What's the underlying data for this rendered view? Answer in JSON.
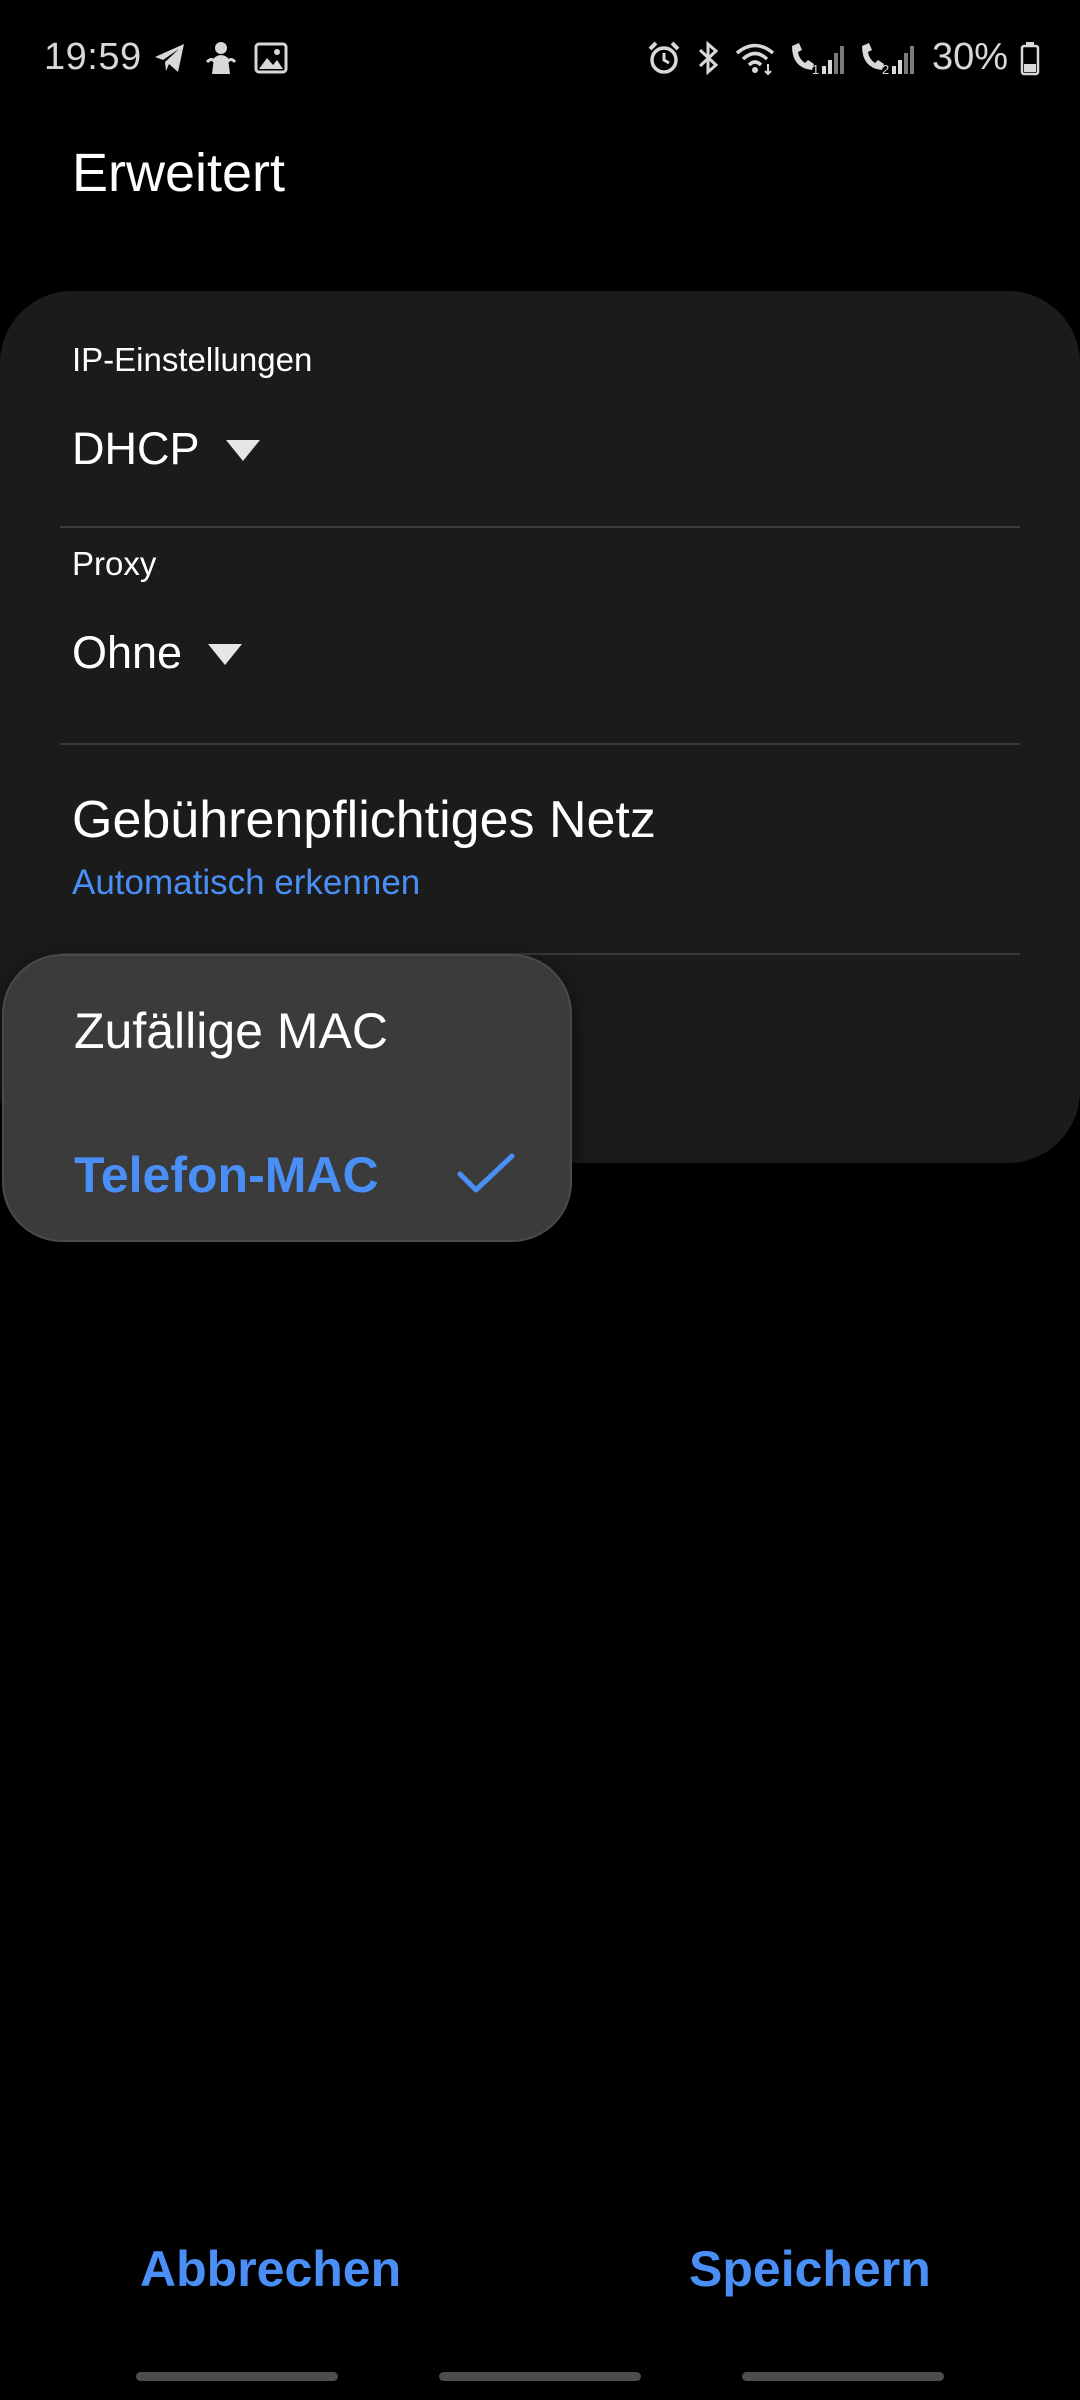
{
  "status_bar": {
    "time": "19:59",
    "battery": "30%",
    "left_icons": [
      "telegram-icon",
      "notification-person-icon",
      "gallery-icon"
    ],
    "right_icons": [
      "alarm-icon",
      "bluetooth-icon",
      "wifi-icon",
      "sim1-call-signal-icon",
      "sim2-call-signal-icon",
      "battery-icon"
    ]
  },
  "page": {
    "title": "Erweitert"
  },
  "ip_settings": {
    "label": "IP-Einstellungen",
    "value": "DHCP"
  },
  "proxy": {
    "label": "Proxy",
    "value": "Ohne"
  },
  "metered_network": {
    "title": "Gebührenpflichtiges Netz",
    "value": "Automatisch erkennen"
  },
  "mac_popup": {
    "options": [
      {
        "label": "Zufällige MAC",
        "selected": false
      },
      {
        "label": "Telefon-MAC",
        "selected": true
      }
    ]
  },
  "buttons": {
    "cancel": "Abbrechen",
    "save": "Speichern"
  },
  "colors": {
    "accent": "#4a8ff5",
    "background": "#000000",
    "card": "#1b1b1b",
    "popup": "#3b3b3b"
  }
}
